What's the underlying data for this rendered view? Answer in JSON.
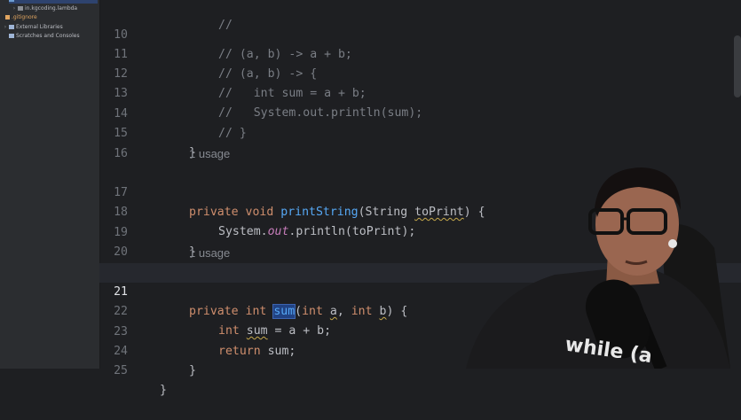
{
  "sidebar": {
    "items": [
      {
        "label": "",
        "glyph": "",
        "icon": "folder-icon"
      },
      {
        "label": "in.kgcoding.lambda",
        "glyph": "›",
        "icon": "package-icon"
      },
      {
        "label": ".gitignore",
        "glyph": "",
        "icon": "file-icon"
      },
      {
        "label": "External Libraries",
        "glyph": "›",
        "icon": "library-icon"
      },
      {
        "label": "Scratches and Consoles",
        "glyph": "",
        "icon": "console-icon"
      }
    ]
  },
  "editor": {
    "line_numbers": [
      "10",
      "11",
      "12",
      "13",
      "14",
      "15",
      "16",
      "17",
      "18",
      "19",
      "20",
      "21",
      "22",
      "23",
      "24",
      "25"
    ],
    "usage_hints": [
      "1 usage",
      "1 usage"
    ],
    "tokens": {
      "l10": "// (a, b) -> a + b;",
      "l11": "// (a, b) -> {",
      "l12": "//   int sum = a + b;",
      "l13": "//   System.out.println(sum);",
      "l14": "// }",
      "l15": "}",
      "kw_private": "private",
      "kw_void": "void",
      "kw_int": "int",
      "kw_return": "return",
      "fn_printString": "printString",
      "p_open": "(",
      "t_String": "String ",
      "v_toPrint": "toPrint",
      "p_close_brace": ") {",
      "sys": "System.",
      "out": "out",
      "println_toPrint": ".println(toPrint);",
      "close_brace": "}",
      "fn_sum": "sum",
      "v_a": "a",
      "comma": ", ",
      "v_b": "b",
      "v_sum": "sum",
      "assign": " = a + b;",
      "ret_sum": " sum;"
    }
  },
  "colors": {
    "background": "#1e1f22",
    "keyword": "#cf8e6d",
    "function": "#56a8f5",
    "comment": "#7a7e85",
    "static_field": "#c77dbb",
    "selection": "#214283"
  },
  "overlay": {
    "shirt_text": "while (a"
  }
}
